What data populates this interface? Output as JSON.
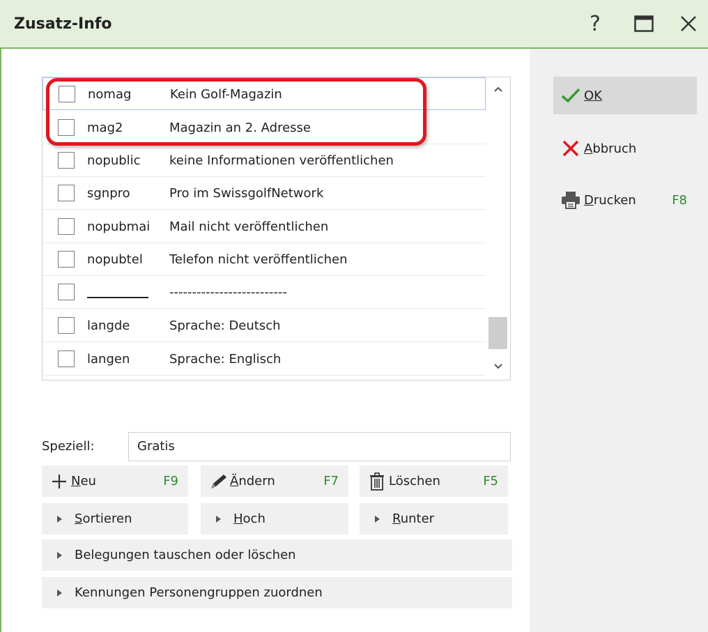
{
  "window": {
    "title": "Zusatz-Info",
    "help_glyph": "?",
    "close_glyph": "✕"
  },
  "list": {
    "rows": [
      {
        "code": "nomag",
        "desc": "Kein Golf-Magazin",
        "checked": false
      },
      {
        "code": "mag2",
        "desc": "Magazin an 2. Adresse",
        "checked": false
      },
      {
        "code": "nopublic",
        "desc": "keine Informationen veröffentlichen",
        "checked": false
      },
      {
        "code": "sgnpro",
        "desc": "Pro im SwissgolfNetwork",
        "checked": false
      },
      {
        "code": "nopubmai",
        "desc": "Mail nicht veröffentlichen",
        "checked": false
      },
      {
        "code": "nopubtel",
        "desc": "Telefon nicht veröffentlichen",
        "checked": false
      },
      {
        "code": "",
        "desc": "--------------------------",
        "checked": false
      },
      {
        "code": "langde",
        "desc": "Sprache: Deutsch",
        "checked": false
      },
      {
        "code": "langen",
        "desc": "Sprache: Englisch",
        "checked": false
      }
    ]
  },
  "right": {
    "ok_label": "OK",
    "cancel_label": "Abbruch",
    "print_label": "Drucken",
    "print_key": "F8"
  },
  "special": {
    "label": "Speziell:",
    "value": "Gratis"
  },
  "actions": {
    "new_label": "Neu",
    "new_key": "F9",
    "edit_label": "Ändern",
    "edit_key": "F7",
    "delete_label": "Löschen",
    "delete_key": "F5",
    "sort_label": "Sortieren",
    "up_label": "Hoch",
    "down_label": "Runter",
    "swap_label": "Belegungen tauschen oder löschen",
    "groups_label": "Kennungen Personengruppen zuordnen"
  },
  "colors": {
    "accent_green": "#7bb661",
    "highlight_red": "#e0181f",
    "key_green": "#2e8b2e"
  }
}
